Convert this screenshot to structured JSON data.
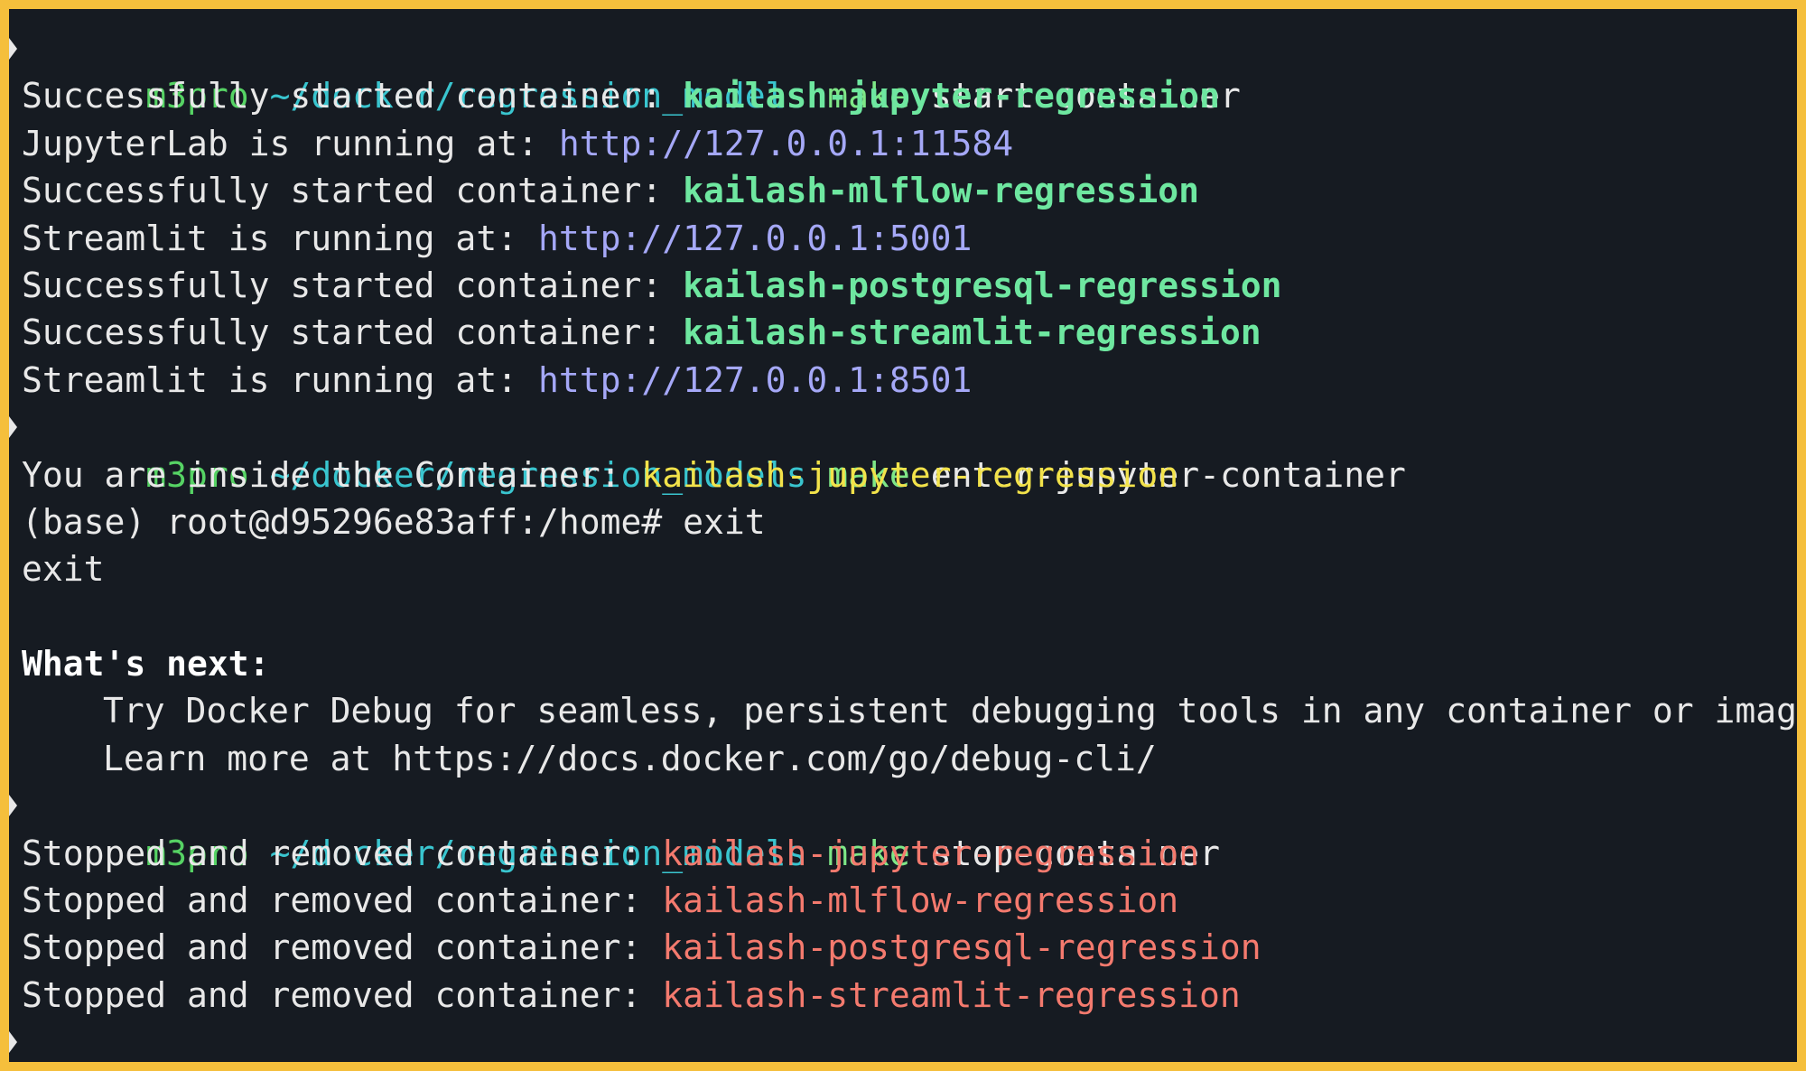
{
  "prompt": {
    "host": "m3pro",
    "path": "~/docker/regression_models"
  },
  "lines": {
    "cmd1_make": "make",
    "cmd1_target": "start-container",
    "l1_text": "Successfully started container: ",
    "l1_value": "kailash-jupyter-regression",
    "l2_text": "JupyterLab is running at: ",
    "l2_value": "http://127.0.0.1:11584",
    "l3_text": "Successfully started container: ",
    "l3_value": "kailash-mlflow-regression",
    "l4_text": "Streamlit is running at: ",
    "l4_value": "http://127.0.0.1:5001",
    "l5_text": "Successfully started container: ",
    "l5_value": "kailash-postgresql-regression",
    "l6_text": "Successfully started container: ",
    "l6_value": "kailash-streamlit-regression",
    "l7_text": "Streamlit is running at: ",
    "l7_value": "http://127.0.0.1:8501",
    "cmd2_make": "make",
    "cmd2_target": "enter-jupyter-container",
    "l8_text": "You are inside the Container: ",
    "l8_value": "kailash-jupyter-regression",
    "l9_text": "(base) root@d95296e83aff:/home# exit",
    "l10_text": "exit",
    "l11_text": "What's next:",
    "l12_text": "Try Docker Debug for seamless, persistent debugging tools in any container or image",
    "l13_text": "Learn more at https://docs.docker.com/go/debug-cli/",
    "cmd3_make": "make",
    "cmd3_target": "stop-container",
    "l14_text": "Stopped and removed container: ",
    "l14_value": "kailash-jupyter-regression",
    "l15_text": "Stopped and removed container: ",
    "l15_value": "kailash-mlflow-regression",
    "l16_text": "Stopped and removed container: ",
    "l16_value": "kailash-postgresql-regression",
    "l17_text": "Stopped and removed container: ",
    "l17_value": "kailash-streamlit-regression"
  },
  "colors": {
    "frame_border": "#f5bf3c",
    "background": "#161b22",
    "success_green": "#6ee7a0",
    "url_blue": "#a5a8f7",
    "inside_yellow": "#f2e24a",
    "stopped_red": "#f47a6e"
  }
}
